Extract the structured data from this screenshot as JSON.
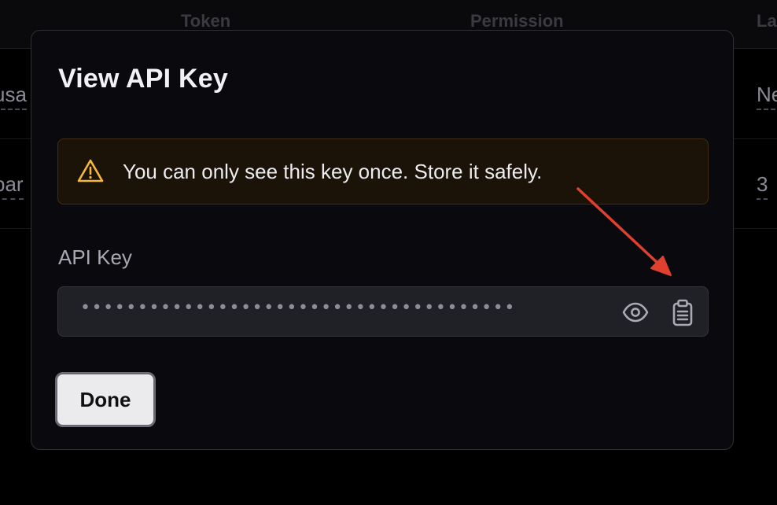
{
  "background_table": {
    "columns": [
      "Token",
      "Permission",
      "La"
    ],
    "rows": [
      {
        "name_cell": "usa",
        "last_cell": "Ne"
      },
      {
        "name_cell": "par",
        "last_cell": "3"
      }
    ]
  },
  "modal": {
    "title": "View API Key",
    "alert": {
      "icon": "warning-icon",
      "text": "You can only see this key once. Store it safely."
    },
    "api_key": {
      "label": "API Key",
      "masked_value": "••••••••••••••••••••••••••••••••••••••",
      "reveal_icon": "eye-icon",
      "copy_icon": "clipboard-icon"
    },
    "done_label": "Done"
  },
  "colors": {
    "alert_icon": "#f5b83d",
    "annotation_arrow": "#e2402e",
    "alert_background": "#1b1208"
  }
}
